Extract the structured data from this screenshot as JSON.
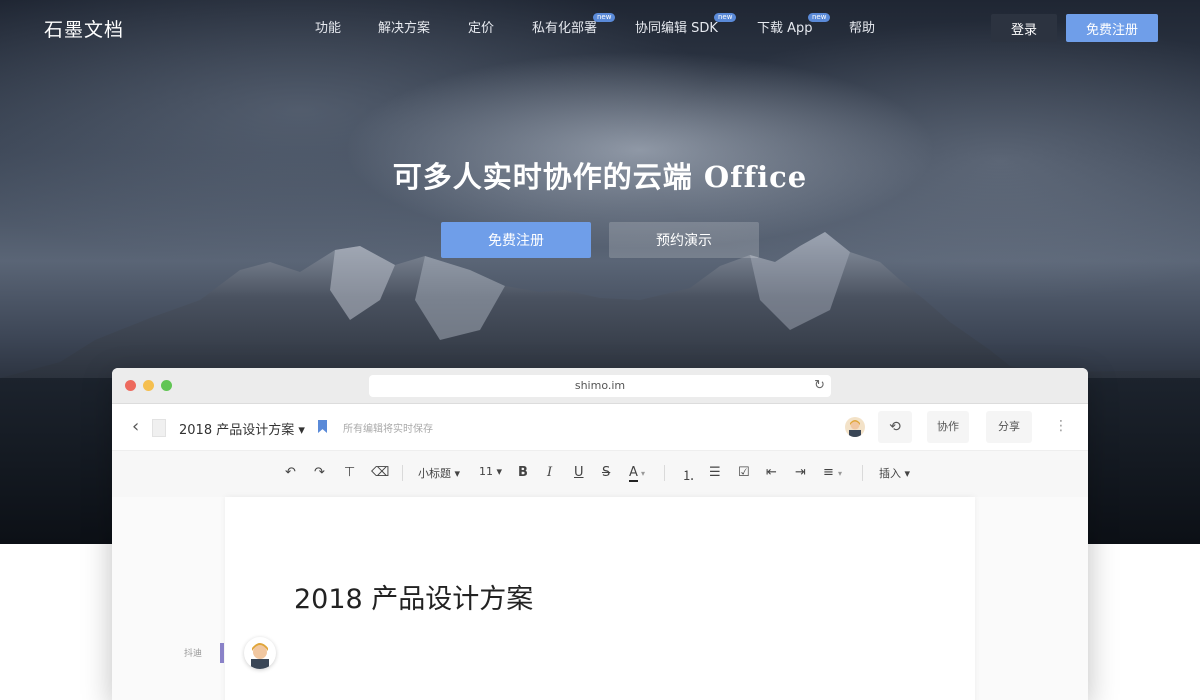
{
  "nav": {
    "logo": "石墨文档",
    "items": [
      {
        "label": "功能"
      },
      {
        "label": "解决方案"
      },
      {
        "label": "定价"
      },
      {
        "label": "私有化部署",
        "badge": "new"
      },
      {
        "label": "协同编辑 SDK",
        "badge": "new"
      },
      {
        "label": "下载 App",
        "badge": "new"
      },
      {
        "label": "帮助"
      }
    ],
    "login": "登录",
    "signup": "免费注册"
  },
  "hero": {
    "title": "可多人实时协作的云端 Office",
    "signup": "免费注册",
    "demo": "预约演示"
  },
  "browser": {
    "url": "shimo.im"
  },
  "doc": {
    "title": "2018 产品设计方案 ▾",
    "save_status": "所有编辑将实时保存",
    "collaborate": "协作",
    "share": "分享",
    "page_title": "2018 产品设计方案",
    "side_label": "抖迪"
  },
  "toolbar": {
    "heading": "小标题 ▾",
    "size": "11 ▾",
    "insert": "插入 ▾"
  },
  "colors": {
    "accent": "#6f9ee9",
    "badge": "#5a8ad8"
  }
}
